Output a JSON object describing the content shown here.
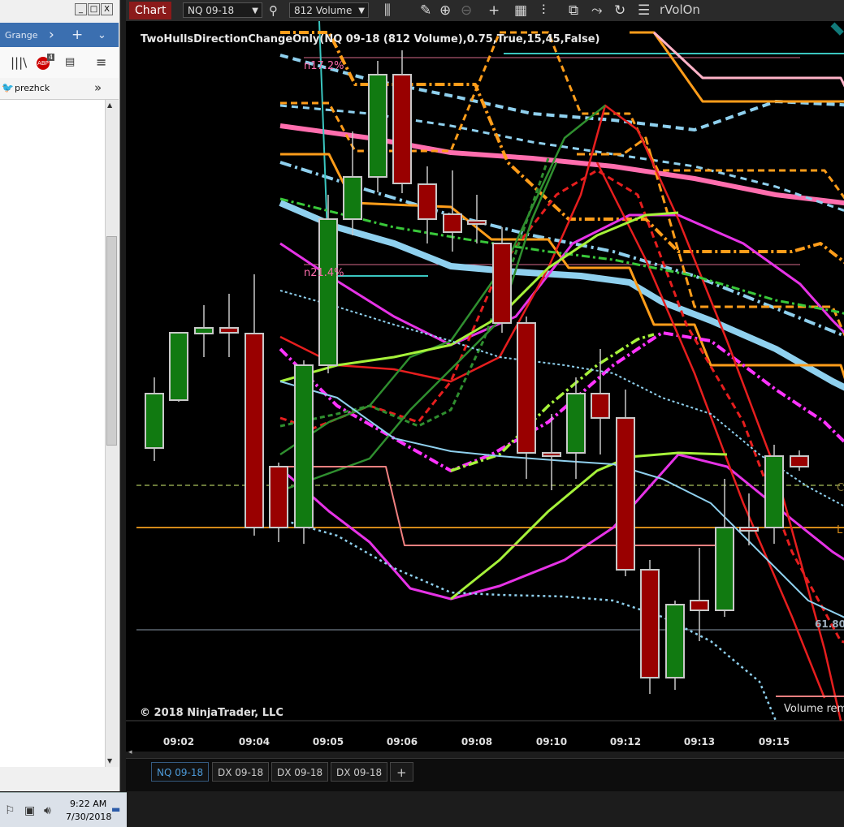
{
  "browser": {
    "tab_title": "Grange",
    "win_buttons": [
      "_",
      "□",
      "X"
    ],
    "bookmark_label": "prezhck",
    "addon_badge": "4",
    "addon_label": "ABP"
  },
  "taskbar": {
    "time": "9:22 AM",
    "date": "7/30/2018"
  },
  "toolbar": {
    "chart_tab": "Chart",
    "instrument": "NQ 09-18",
    "bar_type": "812 Volume",
    "rvol_label": "rVolOn"
  },
  "chart": {
    "indicator_label": "TwoHullsDirectionChangeOnly(NQ 09-18 (812 Volume),0.75,True,15,45,False)",
    "copyright": "© 2018 NinjaTrader, LLC",
    "volume_text": "Volume rem",
    "annotation_top": "n17.2%",
    "annotation_mid": "n21.4%",
    "price_level_label": "61.80",
    "right_label_c": "C",
    "right_label_l": "L",
    "time_labels": [
      "09:02",
      "09:04",
      "09:05",
      "09:06",
      "09:08",
      "09:10",
      "09:12",
      "09:13",
      "09:15"
    ],
    "colors": {
      "bull": "#117a11",
      "bear": "#990000",
      "wick": "#c8c8c8"
    }
  },
  "chart_data": {
    "type": "candlestick",
    "title": "TwoHullsDirectionChangeOnly(NQ 09-18 (812 Volume),0.75,True,15,45,False)",
    "x_labels": [
      "09:02",
      "09:04",
      "09:05",
      "09:06",
      "09:08",
      "09:10",
      "09:12",
      "09:13",
      "09:15"
    ],
    "candles": [
      {
        "o": 552,
        "h": 465,
        "c": 485,
        "l": 568
      },
      {
        "o": 493,
        "h": 410,
        "c": 410,
        "l": 495
      },
      {
        "o": 411,
        "h": 376,
        "c": 404,
        "l": 440
      },
      {
        "o": 404,
        "h": 362,
        "c": 410,
        "l": 440
      },
      {
        "o": 411,
        "h": 338,
        "c": 650,
        "l": 660
      },
      {
        "o": 575,
        "h": 570,
        "c": 650,
        "l": 668
      },
      {
        "o": 650,
        "h": 444,
        "c": 450,
        "l": 670
      },
      {
        "o": 450,
        "h": 240,
        "c": 270,
        "l": 460
      },
      {
        "o": 270,
        "h": 162,
        "c": 218,
        "l": 290
      },
      {
        "o": 218,
        "h": 75,
        "c": 92,
        "l": 237
      },
      {
        "o": 92,
        "h": 62,
        "c": 226,
        "l": 238
      },
      {
        "o": 227,
        "h": 205,
        "c": 270,
        "l": 300
      },
      {
        "o": 264,
        "h": 210,
        "c": 286,
        "l": 310
      },
      {
        "o": 272,
        "h": 240,
        "c": 272,
        "l": 300
      },
      {
        "o": 300,
        "h": 280,
        "c": 398,
        "l": 410
      },
      {
        "o": 398,
        "h": 390,
        "c": 558,
        "l": 590
      },
      {
        "o": 558,
        "h": 510,
        "c": 558,
        "l": 604
      },
      {
        "o": 558,
        "h": 465,
        "c": 485,
        "l": 590
      },
      {
        "o": 485,
        "h": 430,
        "c": 515,
        "l": 560
      },
      {
        "o": 515,
        "h": 480,
        "c": 702,
        "l": 710
      },
      {
        "o": 702,
        "h": 690,
        "c": 835,
        "l": 855
      },
      {
        "o": 835,
        "h": 740,
        "c": 745,
        "l": 850
      },
      {
        "o": 740,
        "h": 675,
        "c": 752,
        "l": 790
      },
      {
        "o": 752,
        "h": 590,
        "c": 650,
        "l": 760
      },
      {
        "o": 650,
        "h": 608,
        "c": 650,
        "l": 672
      },
      {
        "o": 650,
        "h": 548,
        "c": 562,
        "l": 670
      },
      {
        "o": 562,
        "h": 555,
        "c": 575,
        "l": 580
      }
    ],
    "price_levels": [
      {
        "label": "61.80"
      }
    ]
  }
}
